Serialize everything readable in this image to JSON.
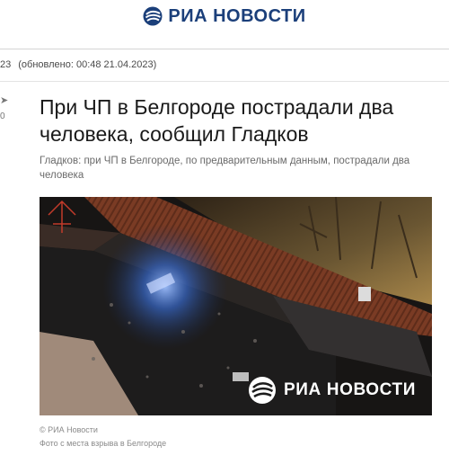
{
  "header": {
    "brand": "РИА НОВОСТИ",
    "logo_icon": "ria-logo-icon"
  },
  "meta": {
    "date_fragment": "23",
    "updated": "(обновлено: 00:48 21.04.2023)"
  },
  "sidebar": {
    "share_icon": "share-arrow-icon",
    "count": "0"
  },
  "article": {
    "title": "При ЧП в Белгороде пострадали два человека, сообщил Гладков",
    "subtitle": "Гладков: при ЧП в Белгороде, по предварительным данным, пострадали два человека"
  },
  "photo": {
    "watermark": "РИА НОВОСТИ",
    "credit": "© РИА Новости",
    "caption": "Фото с места взрыва в Белгороде"
  },
  "colors": {
    "brand": "#1b3f7a",
    "roof": "#7a3b24",
    "light": "#3a6fd8"
  }
}
